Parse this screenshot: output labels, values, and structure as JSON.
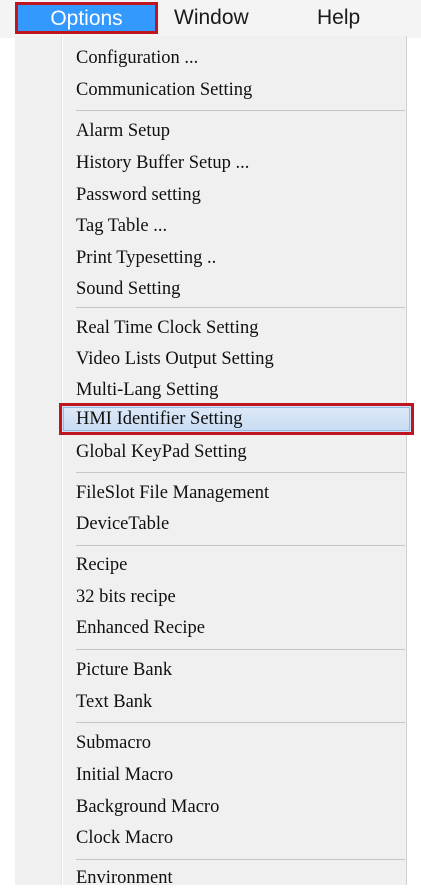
{
  "menubar": {
    "items": [
      {
        "label": "Options"
      },
      {
        "label": "Window"
      },
      {
        "label": "Help"
      }
    ]
  },
  "colors": {
    "menubar_active_bg": "#3399ff",
    "annotation_border": "#c0141e",
    "highlight_bg": "#cce0f7",
    "menu_bg": "#f0f0f0"
  },
  "menu": {
    "items": [
      {
        "label": "Configuration ..."
      },
      {
        "label": "Communication Setting"
      },
      {
        "label": "Alarm Setup"
      },
      {
        "label": "History Buffer Setup ..."
      },
      {
        "label": "Password setting"
      },
      {
        "label": "Tag Table ..."
      },
      {
        "label": "Print Typesetting .."
      },
      {
        "label": "Sound Setting"
      },
      {
        "label": "Real Time Clock Setting"
      },
      {
        "label": "Video Lists Output Setting"
      },
      {
        "label": "Multi-Lang Setting"
      },
      {
        "label": "HMI Identifier Setting"
      },
      {
        "label": "Global KeyPad Setting"
      },
      {
        "label": "FileSlot File Management"
      },
      {
        "label": "DeviceTable"
      },
      {
        "label": "Recipe"
      },
      {
        "label": "32 bits recipe"
      },
      {
        "label": "Enhanced Recipe"
      },
      {
        "label": "Picture Bank"
      },
      {
        "label": "Text Bank"
      },
      {
        "label": "Submacro"
      },
      {
        "label": "Initial Macro"
      },
      {
        "label": "Background Macro"
      },
      {
        "label": "Clock Macro"
      },
      {
        "label": "Environment"
      }
    ],
    "highlighted_item": "HMI Identifier Setting"
  }
}
